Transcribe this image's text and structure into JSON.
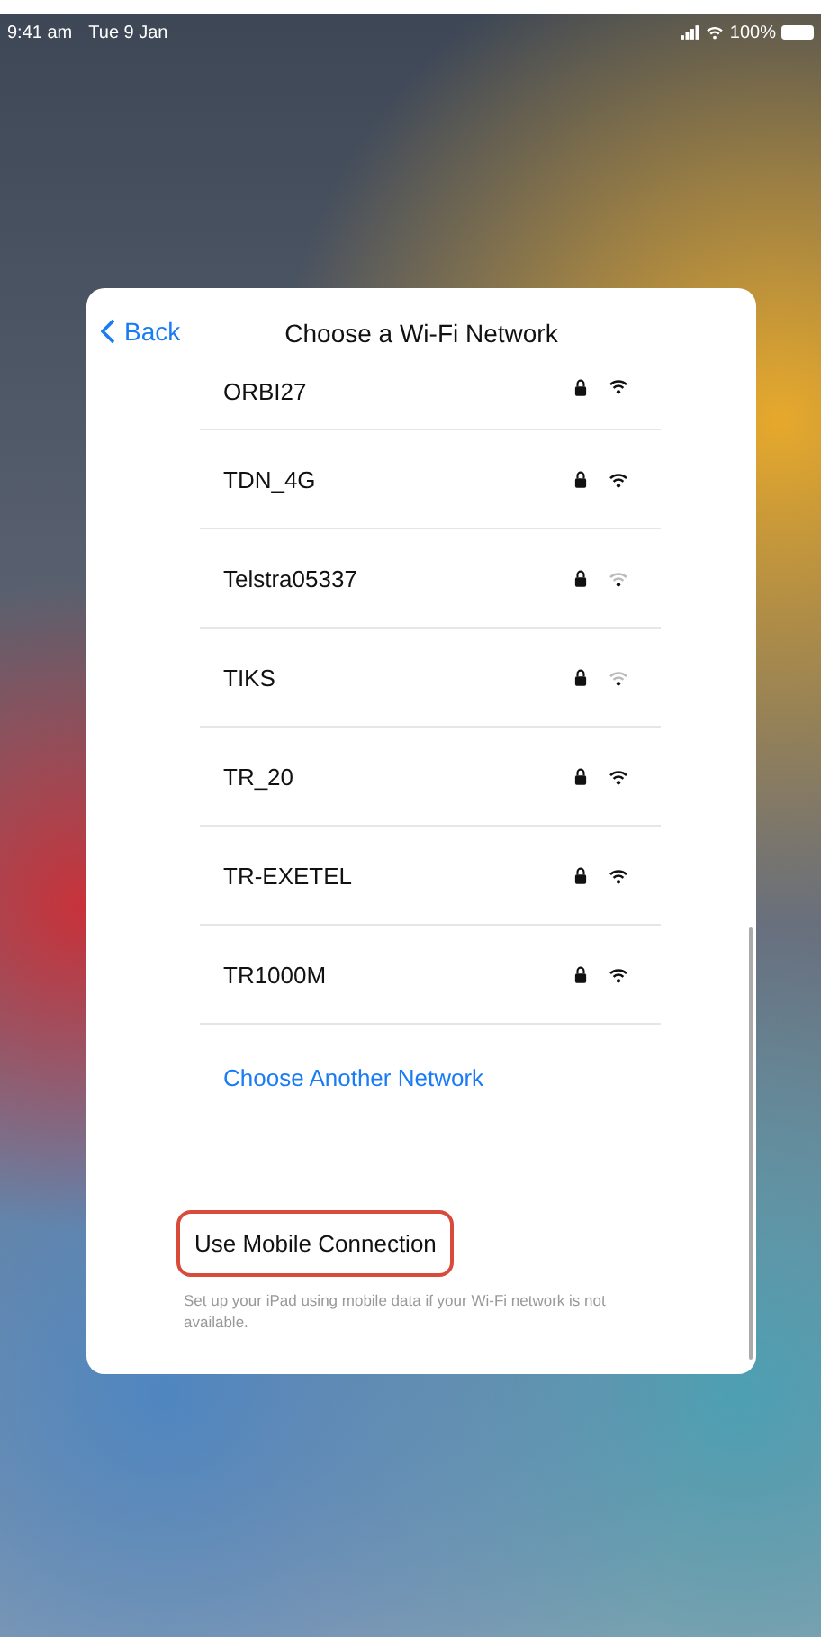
{
  "status_bar": {
    "time": "9:41 am",
    "date": "Tue 9 Jan",
    "battery": "100%"
  },
  "sheet": {
    "back": "Back",
    "title": "Choose a Wi-Fi Network",
    "networks": [
      {
        "name": "ORBI27",
        "locked": true,
        "weak_signal": false
      },
      {
        "name": "TDN_4G",
        "locked": true,
        "weak_signal": false
      },
      {
        "name": "Telstra05337",
        "locked": true,
        "weak_signal": true
      },
      {
        "name": "TIKS",
        "locked": true,
        "weak_signal": true
      },
      {
        "name": "TR_20",
        "locked": true,
        "weak_signal": false
      },
      {
        "name": "TR-EXETEL",
        "locked": true,
        "weak_signal": false
      },
      {
        "name": "TR1000M",
        "locked": true,
        "weak_signal": false
      }
    ],
    "other_network": "Choose Another Network",
    "mobile": {
      "label": "Use Mobile Connection",
      "highlighted": true
    },
    "mobile_note": "Set up your iPad using mobile data if your Wi-Fi network is not available."
  }
}
